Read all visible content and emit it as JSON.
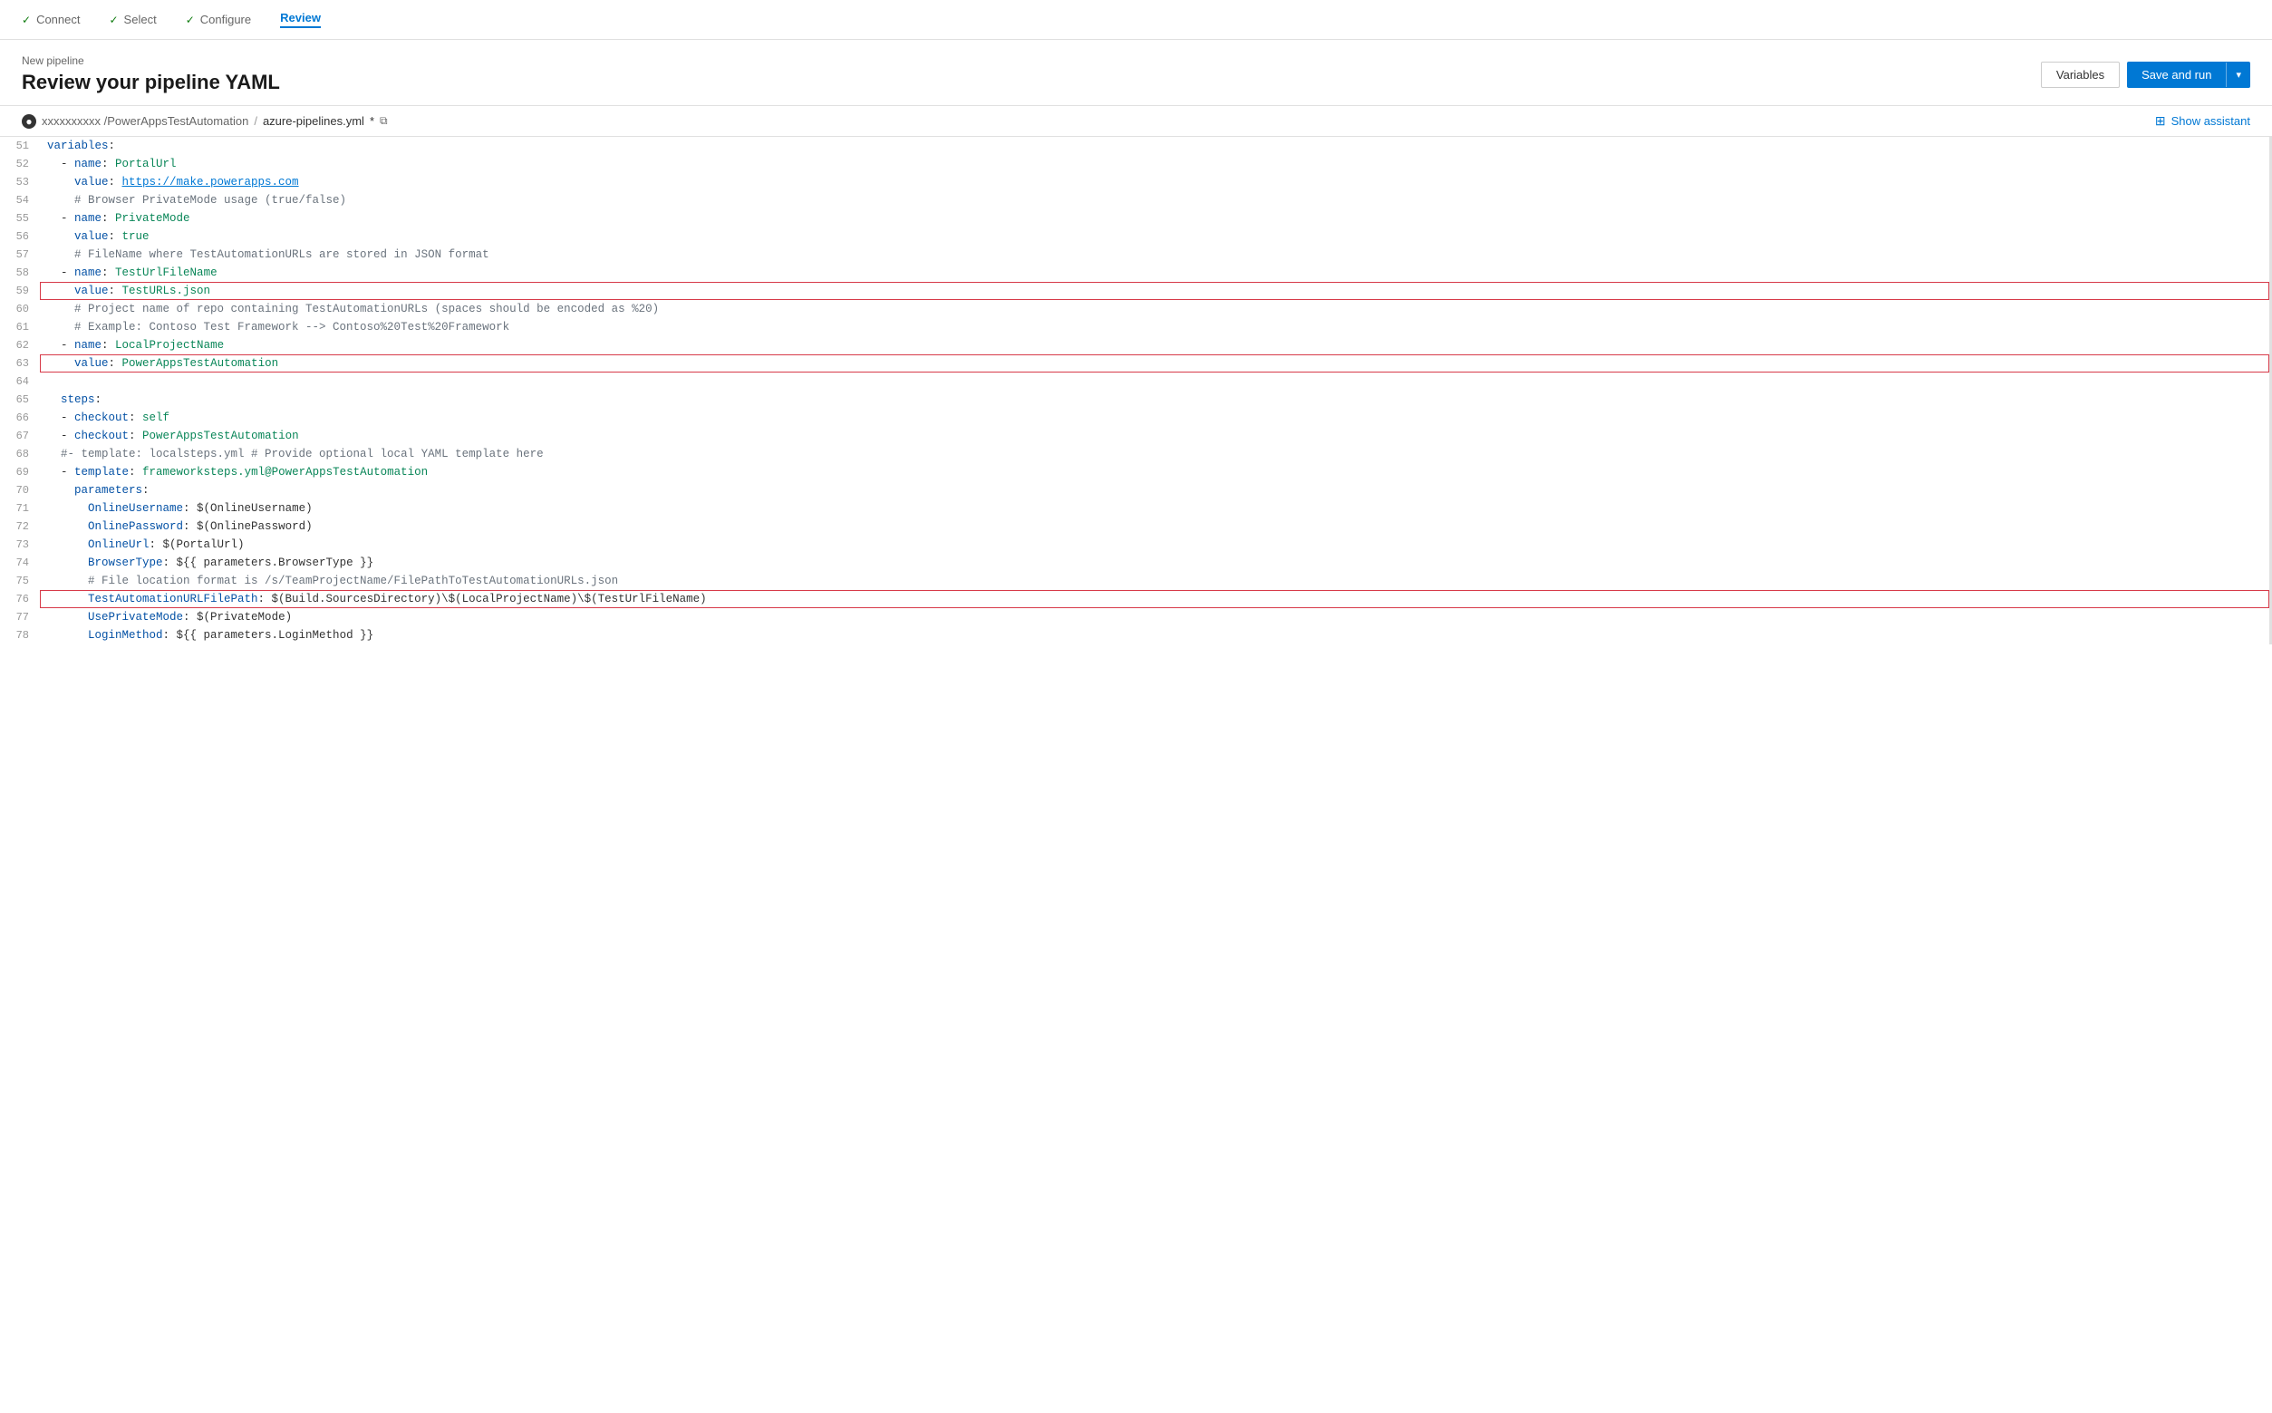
{
  "wizard": {
    "steps": [
      {
        "id": "connect",
        "label": "Connect",
        "checked": true,
        "active": false
      },
      {
        "id": "select",
        "label": "Select",
        "checked": true,
        "active": false
      },
      {
        "id": "configure",
        "label": "Configure",
        "checked": true,
        "active": false
      },
      {
        "id": "review",
        "label": "Review",
        "checked": false,
        "active": true
      }
    ]
  },
  "header": {
    "breadcrumb": "New pipeline",
    "title": "Review your pipeline YAML",
    "variables_btn": "Variables",
    "save_run_btn": "Save and run"
  },
  "filepath": {
    "repo": "xxxxxxxxxx /PowerAppsTestAutomation",
    "separator": "/",
    "filename": "azure-pipelines.yml",
    "modified": "*",
    "show_assistant": "Show assistant"
  },
  "lines": [
    {
      "num": 51,
      "content": "variables:",
      "type": "key"
    },
    {
      "num": 52,
      "content": "  - name: PortalUrl",
      "type": "mixed"
    },
    {
      "num": 53,
      "content": "    value: https://make.powerapps.com",
      "type": "url"
    },
    {
      "num": 54,
      "content": "    # Browser PrivateMode usage (true/false)",
      "type": "comment"
    },
    {
      "num": 55,
      "content": "  - name: PrivateMode",
      "type": "mixed"
    },
    {
      "num": 56,
      "content": "    value: true",
      "type": "mixed"
    },
    {
      "num": 57,
      "content": "    # FileName where TestAutomationURLs are stored in JSON format",
      "type": "comment"
    },
    {
      "num": 58,
      "content": "  - name: TestUrlFileName",
      "type": "mixed"
    },
    {
      "num": 59,
      "content": "    value: TestURLs.json",
      "type": "mixed",
      "highlight": true
    },
    {
      "num": 60,
      "content": "    # Project name of repo containing TestAutomationURLs (spaces should be encoded as %20)",
      "type": "comment"
    },
    {
      "num": 61,
      "content": "    # Example: Contoso Test Framework --> Contoso%20Test%20Framework",
      "type": "comment"
    },
    {
      "num": 62,
      "content": "  - name: LocalProjectName",
      "type": "mixed"
    },
    {
      "num": 63,
      "content": "    value: PowerAppsTestAutomation",
      "type": "mixed",
      "highlight": true
    },
    {
      "num": 64,
      "content": "",
      "type": "empty"
    },
    {
      "num": 65,
      "content": "  steps:",
      "type": "key"
    },
    {
      "num": 66,
      "content": "  - checkout: self",
      "type": "mixed"
    },
    {
      "num": 67,
      "content": "  - checkout: PowerAppsTestAutomation",
      "type": "mixed"
    },
    {
      "num": 68,
      "content": "  #- template: localsteps.yml # Provide optional local YAML template here",
      "type": "comment"
    },
    {
      "num": 69,
      "content": "  - template: frameworksteps.yml@PowerAppsTestAutomation",
      "type": "mixed"
    },
    {
      "num": 70,
      "content": "    parameters:",
      "type": "key"
    },
    {
      "num": 71,
      "content": "      OnlineUsername: $(OnlineUsername)",
      "type": "mixed"
    },
    {
      "num": 72,
      "content": "      OnlinePassword: $(OnlinePassword)",
      "type": "mixed"
    },
    {
      "num": 73,
      "content": "      OnlineUrl: $(PortalUrl)",
      "type": "mixed"
    },
    {
      "num": 74,
      "content": "      BrowserType: ${{ parameters.BrowserType }}",
      "type": "mixed"
    },
    {
      "num": 75,
      "content": "      # File location format is /s/TeamProjectName/FilePathToTestAutomationURLs.json",
      "type": "comment"
    },
    {
      "num": 76,
      "content": "      TestAutomationURLFilePath: $(Build.SourcesDirectory)\\$(LocalProjectName)\\$(TestUrlFileName)",
      "type": "mixed",
      "highlight": true
    },
    {
      "num": 77,
      "content": "      UsePrivateMode: $(PrivateMode)",
      "type": "mixed"
    },
    {
      "num": 78,
      "content": "      LoginMethod: ${{ parameters.LoginMethod }}",
      "type": "mixed"
    }
  ],
  "colors": {
    "accent_blue": "#0078d4",
    "active_tab_blue": "#0078d4",
    "highlight_border": "#d73a49"
  }
}
